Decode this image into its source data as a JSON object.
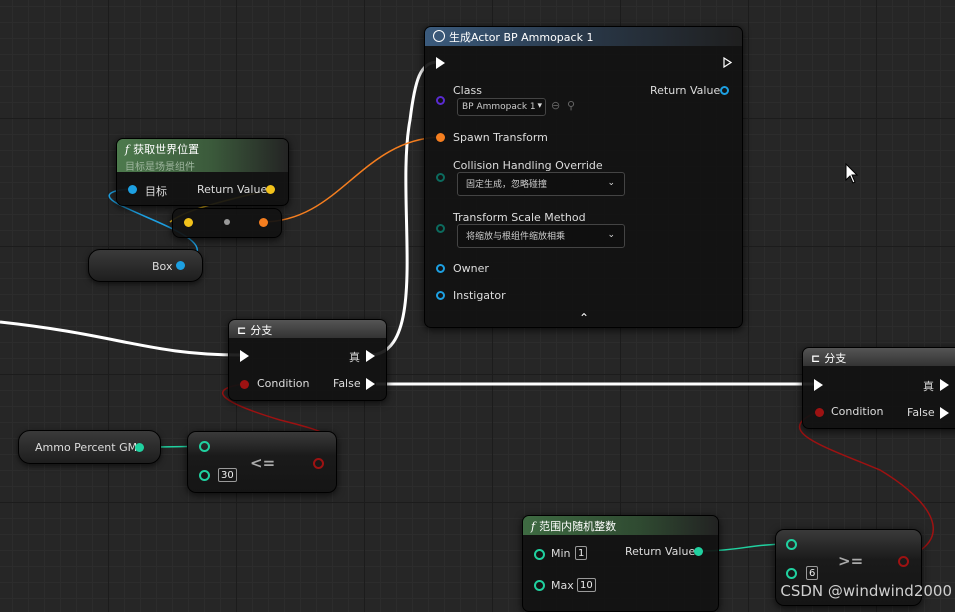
{
  "spawn_node": {
    "title": "生成Actor BP Ammopack 1",
    "class_label": "Class",
    "class_value": "BP Ammopack 1",
    "return_label": "Return Value",
    "spawn_transform": "Spawn Transform",
    "collision_label": "Collision Handling Override",
    "collision_value": "固定生成，忽略碰撞",
    "scale_label": "Transform Scale Method",
    "scale_value": "将缩放与根组件缩放相乘",
    "owner": "Owner",
    "instigator": "Instigator",
    "collapse": "⌃"
  },
  "location_node": {
    "title": "获取世界位置",
    "subtitle": "目标是场景组件",
    "target": "目标",
    "return_label": "Return Value"
  },
  "box_var": {
    "label": "Box"
  },
  "branch1": {
    "title": "分支",
    "true_label": "真",
    "condition": "Condition",
    "false_label": "False"
  },
  "branch2": {
    "title": "分支",
    "true_label": "真",
    "condition": "Condition",
    "false_label": "False"
  },
  "ammo_var": {
    "label": "Ammo Percent GM"
  },
  "compare1": {
    "op": "<=",
    "value": "30"
  },
  "random_node": {
    "title": "范围内随机整数",
    "min_label": "Min",
    "min_value": "1",
    "max_label": "Max",
    "max_value": "10",
    "return_label": "Return Value"
  },
  "compare2": {
    "op": ">=",
    "value": "6"
  },
  "watermark": "CSDN @windwind2000",
  "colors": {
    "exec": "#ffffff",
    "class_pin": "#5a2bd1",
    "transform_pin": "#f57e1f",
    "object_pin": "#1da0e2",
    "vector_pin": "#f2c21b",
    "bool_pin": "#9d1212",
    "int_pin": "#20d1a0",
    "enum_pin": "#0c6b5e"
  }
}
